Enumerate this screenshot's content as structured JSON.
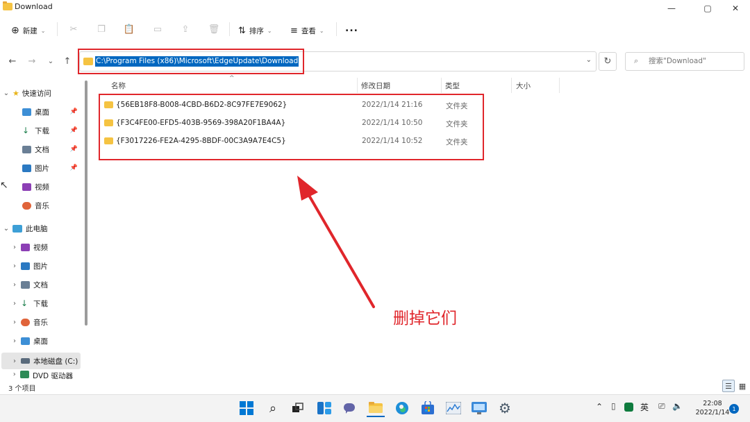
{
  "window": {
    "title": "Download",
    "minimize": "—",
    "maximize": "▢",
    "close": "✕"
  },
  "toolbar": {
    "new_label": "新建",
    "sort_label": "排序",
    "view_label": "查看",
    "more_label": "..."
  },
  "address": {
    "path": "C:\\Program Files (x86)\\Microsoft\\EdgeUpdate\\Download",
    "search_placeholder": "搜索\"Download\""
  },
  "sidebar": {
    "quick_access": "快速访问",
    "quick_items": [
      {
        "label": "桌面",
        "pinned": true,
        "icon": "desktop-icon"
      },
      {
        "label": "下载",
        "pinned": true,
        "icon": "download-icon"
      },
      {
        "label": "文档",
        "pinned": true,
        "icon": "document-icon"
      },
      {
        "label": "图片",
        "pinned": true,
        "icon": "picture-icon"
      },
      {
        "label": "视频",
        "pinned": false,
        "icon": "video-icon"
      },
      {
        "label": "音乐",
        "pinned": false,
        "icon": "music-icon"
      }
    ],
    "this_pc": "此电脑",
    "pc_items": [
      {
        "label": "视频",
        "icon": "video-icon"
      },
      {
        "label": "图片",
        "icon": "picture-icon"
      },
      {
        "label": "文档",
        "icon": "document-icon"
      },
      {
        "label": "下载",
        "icon": "download-icon"
      },
      {
        "label": "音乐",
        "icon": "music-icon"
      },
      {
        "label": "桌面",
        "icon": "desktop-icon"
      },
      {
        "label": "本地磁盘 (C:)",
        "icon": "drive-icon"
      },
      {
        "label": "DVD 驱动器 (D",
        "icon": "dvd-icon"
      }
    ]
  },
  "columns": {
    "name": "名称",
    "date": "修改日期",
    "type": "类型",
    "size": "大小"
  },
  "files": [
    {
      "name": "{56EB18F8-B008-4CBD-B6D2-8C97FE7E9062}",
      "date": "2022/1/14 21:16",
      "type": "文件夹"
    },
    {
      "name": "{F3C4FE00-EFD5-403B-9569-398A20F1BA4A}",
      "date": "2022/1/14 10:50",
      "type": "文件夹"
    },
    {
      "name": "{F3017226-FE2A-4295-8BDF-00C3A9A7E4C5}",
      "date": "2022/1/14 10:52",
      "type": "文件夹"
    }
  ],
  "annotation": {
    "text": "删掉它们",
    "color": "#e0262b"
  },
  "status": {
    "item_count": "3 个项目"
  },
  "taskbar": {
    "input_method": "英",
    "time": "22:08",
    "date": "2022/1/14",
    "notification_count": "1"
  },
  "colors": {
    "accent": "#0067c0",
    "folder": "#f5c342",
    "highlight_red": "#e0262b"
  }
}
